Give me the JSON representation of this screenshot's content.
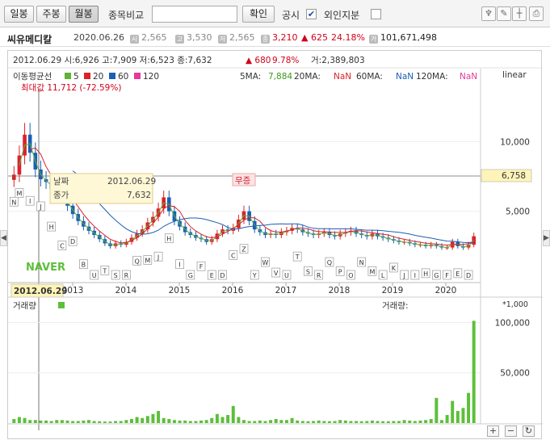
{
  "toolbar": {
    "period_buttons": [
      "일봉",
      "주봉",
      "월봉"
    ],
    "compare_label": "종목비교",
    "compare_value": "",
    "confirm_label": "확인",
    "disclosure_label": "공시",
    "disclosure_checked": "✔",
    "foreign_label": "외인지분",
    "foreign_checked": ""
  },
  "info": {
    "stock_name": "씨유메디칼",
    "date": "2020.06.26",
    "open_badge": "시",
    "open": "2,565",
    "high_badge": "고",
    "high": "3,530",
    "low_badge": "저",
    "low": "2,565",
    "close_badge": "종",
    "close": "3,210",
    "change": "▲ 625",
    "change_pct": "24.18%",
    "volume_badge": "거",
    "volume": "101,671,498"
  },
  "chart": {
    "header_text": "2012.06.29 시:6,926 고:7,909 저:6,523 종:7,632",
    "header_change": "▲ 680",
    "header_pct": "9.78%",
    "header_volume": "거:2,389,803",
    "ma_title": "이동평균선",
    "ma_periods": [
      "5",
      "20",
      "60",
      "120"
    ],
    "ma_colors": [
      "#5fb336",
      "#d9232a",
      "#1a5fb4",
      "#e6399b"
    ],
    "ma_values_label": "5MA:",
    "ma5_value": "7,884",
    "ma20_label": "20MA:",
    "ma20_value": "NaN",
    "ma60_label": "60MA:",
    "ma60_value": "NaN",
    "ma120_label": "120MA:",
    "ma120_value": "NaN",
    "scale_label": "linear",
    "max_label": "최대값 11,712 (-72.59%)",
    "tooltip_date_label": "날짜",
    "tooltip_date": "2012.06.29",
    "tooltip_close_label": "종가",
    "tooltip_close": "7,632",
    "current_price_tag": "6,758",
    "no_dividend_tag": "무증",
    "cursor_date_tag": "2012.06.29",
    "volume_title": "거래량",
    "volume_legend": "거래량:",
    "volume_unit": "*1,000",
    "brand": "NAVER"
  },
  "chart_data": {
    "type": "candlestick",
    "x_axis_labels": [
      "2013",
      "2014",
      "2015",
      "2016",
      "2017",
      "2018",
      "2019",
      "2020"
    ],
    "price_axis_ticks": [
      10000,
      5000
    ],
    "price_axis_tick_labels": [
      "10,000",
      "5,000"
    ],
    "volume_axis_ticks": [
      100000,
      50000
    ],
    "volume_axis_tick_labels": [
      "100,000",
      "50,000"
    ],
    "ylim_price": [
      0,
      13500
    ],
    "ylim_volume": [
      0,
      110000
    ],
    "closes": [
      7632,
      9000,
      10500,
      9200,
      8000,
      7300,
      7100,
      6600,
      6300,
      6000,
      5400,
      4800,
      4300,
      3900,
      3600,
      3300,
      3000,
      2700,
      2500,
      2700,
      2600,
      2800,
      3100,
      3400,
      3700,
      4200,
      4600,
      5200,
      6000,
      5000,
      4300,
      3900,
      3500,
      3300,
      3100,
      3000,
      2800,
      3000,
      3400,
      3700,
      3600,
      3800,
      4400,
      5000,
      4300,
      3700,
      3500,
      3300,
      3400,
      3300,
      3500,
      3600,
      3800,
      3700,
      3500,
      3400,
      3300,
      3400,
      3500,
      3300,
      3200,
      3400,
      3500,
      3600,
      3400,
      3300,
      3200,
      3400,
      3200,
      3100,
      3000,
      2900,
      2800,
      2800,
      2700,
      2600,
      2600,
      2500,
      2600,
      2500,
      2400,
      2400,
      2800,
      2500,
      2400,
      2600,
      3210
    ],
    "volumes": [
      4000,
      6000,
      5000,
      3000,
      3000,
      2500,
      2500,
      2000,
      3000,
      3000,
      2500,
      2000,
      2000,
      2500,
      3000,
      2000,
      1800,
      1500,
      1500,
      2000,
      2000,
      3000,
      4000,
      6000,
      5000,
      7000,
      9000,
      12000,
      5000,
      4000,
      3000,
      2500,
      2500,
      2000,
      2000,
      2500,
      3000,
      5000,
      9000,
      6000,
      8000,
      17000,
      6000,
      3000,
      2000,
      2000,
      2500,
      2000,
      3000,
      4000,
      3000,
      3000,
      5000,
      2500,
      2000,
      1800,
      2000,
      2500,
      2000,
      1800,
      2000,
      3000,
      2500,
      2000,
      2000,
      1800,
      2000,
      2500,
      2000,
      1800,
      1800,
      2000,
      2000,
      3000,
      2500,
      2000,
      2500,
      3000,
      4000,
      25000,
      3000,
      8000,
      22000,
      12000,
      15000,
      30000,
      101671
    ]
  }
}
